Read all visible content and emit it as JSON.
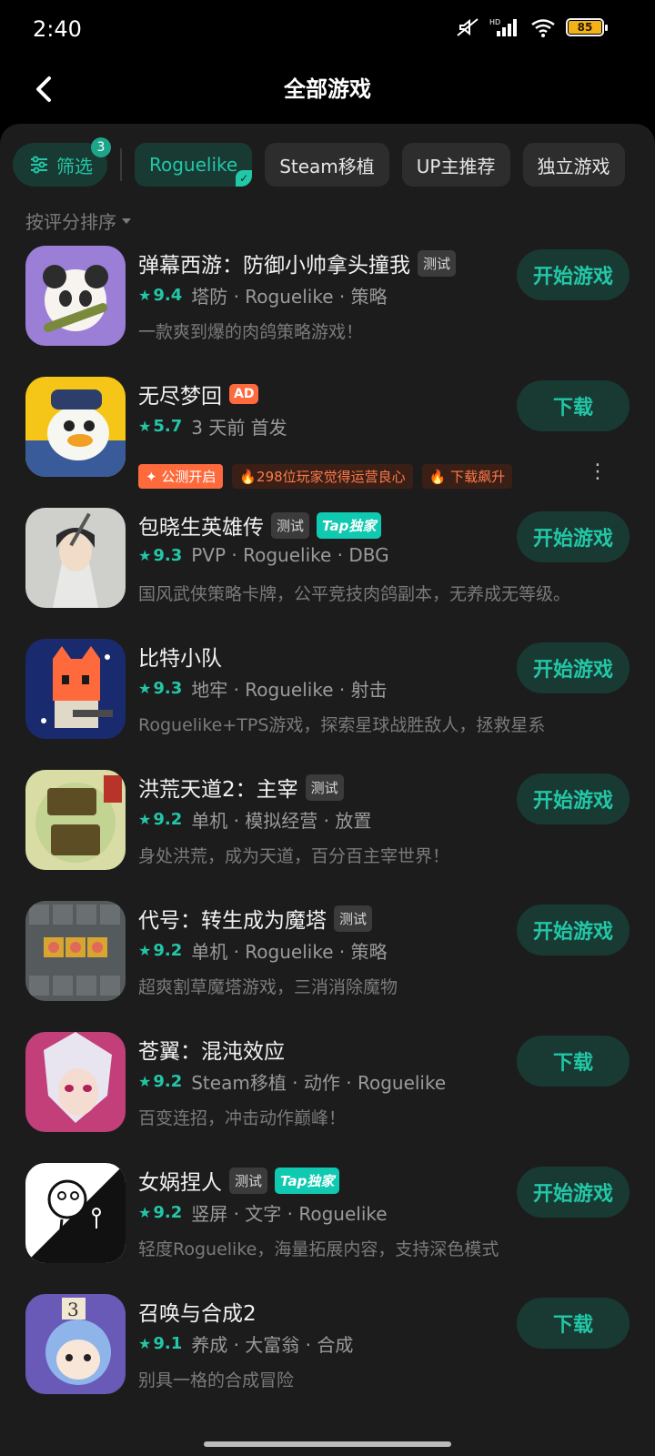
{
  "status": {
    "time": "2:40",
    "battery": "85"
  },
  "header": {
    "title": "全部游戏",
    "back_icon": "chevron-left-icon"
  },
  "filters": {
    "filter_label": "筛选",
    "filter_count": "3",
    "chips": [
      "Roguelike",
      "Steam移植",
      "UP主推荐",
      "独立游戏"
    ]
  },
  "sort": {
    "label": "按评分排序"
  },
  "colors": {
    "accent": "#22c7a7",
    "bg": "#1c1c1c",
    "ad": "#ff6a3d"
  },
  "games": [
    {
      "name": "弹幕西游：防御小帅拿头撞我",
      "tags": [
        "测试"
      ],
      "score": "9.4",
      "meta": "塔防 · Roguelike · 策略",
      "desc": "一款爽到爆的肉鸽策略游戏！",
      "button": "开始游戏"
    },
    {
      "name": "无尽梦回",
      "tags": [
        "AD"
      ],
      "score": "5.7",
      "meta": "3 天前 首发",
      "promo": [
        "公测开启",
        "298位玩家觉得运营良心",
        "下载飙升"
      ],
      "button": "下载"
    },
    {
      "name": "包晓生英雄传",
      "tags": [
        "测试",
        "Tap独家"
      ],
      "score": "9.3",
      "meta": "PVP · Roguelike · DBG",
      "desc": "国风武侠策略卡牌，公平竞技肉鸽副本，无养成无等级。",
      "button": "开始游戏"
    },
    {
      "name": "比特小队",
      "tags": [],
      "score": "9.3",
      "meta": "地牢 · Roguelike · 射击",
      "desc": "Roguelike+TPS游戏，探索星球战胜敌人，拯救星系",
      "button": "开始游戏"
    },
    {
      "name": "洪荒天道2：主宰",
      "tags": [
        "测试"
      ],
      "score": "9.2",
      "meta": "单机 · 模拟经营 · 放置",
      "desc": "身处洪荒，成为天道，百分百主宰世界！",
      "button": "开始游戏"
    },
    {
      "name": "代号：转生成为魔塔",
      "tags": [
        "测试"
      ],
      "score": "9.2",
      "meta": "单机 · Roguelike · 策略",
      "desc": "超爽割草魔塔游戏，三消消除魔物",
      "button": "开始游戏"
    },
    {
      "name": "苍翼：混沌效应",
      "tags": [],
      "score": "9.2",
      "meta": "Steam移植 · 动作 · Roguelike",
      "desc": "百变连招，冲击动作巅峰！",
      "button": "下载"
    },
    {
      "name": "女娲捏人",
      "tags": [
        "测试",
        "Tap独家"
      ],
      "score": "9.2",
      "meta": "竖屏 · 文字 · Roguelike",
      "desc": "轻度Roguelike，海量拓展内容，支持深色模式",
      "button": "开始游戏"
    },
    {
      "name": "召唤与合成2",
      "tags": [],
      "score": "9.1",
      "meta": "养成 · 大富翁 · 合成",
      "desc": "别具一格的合成冒险",
      "button": "下载"
    }
  ]
}
